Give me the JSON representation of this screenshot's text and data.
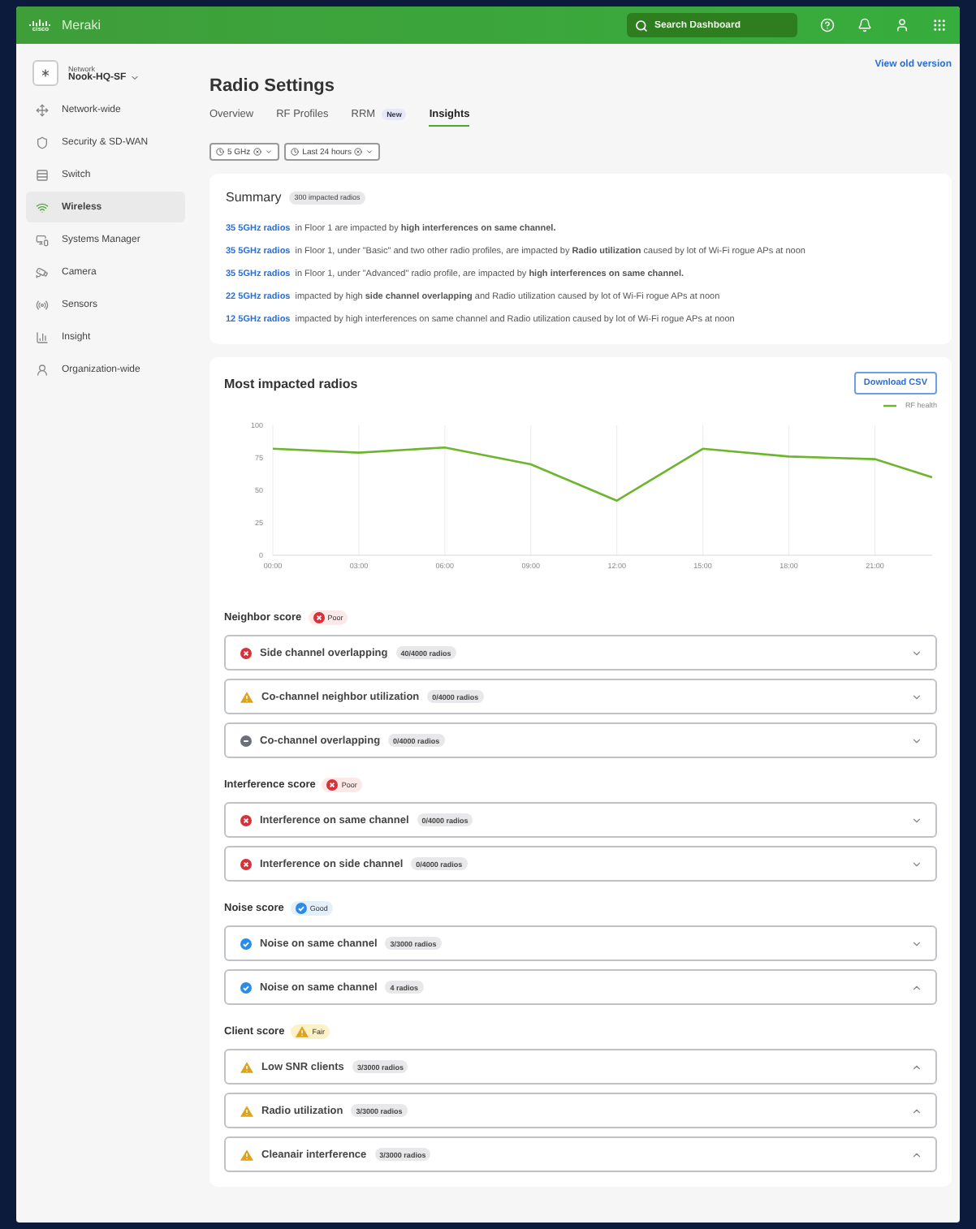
{
  "header": {
    "logo_mark": "cisco",
    "brand": "Meraki",
    "search": {
      "placeholder": "Search Dashboard"
    }
  },
  "sidebar": {
    "network_label": "Network",
    "network_name": "Nook-HQ-SF",
    "items": [
      {
        "label": "Network-wide",
        "selected": false
      },
      {
        "label": "Security & SD-WAN",
        "selected": false
      },
      {
        "label": "Switch",
        "selected": false
      },
      {
        "label": "Wireless",
        "selected": true
      },
      {
        "label": "Systems Manager",
        "selected": false
      },
      {
        "label": "Camera",
        "selected": false
      },
      {
        "label": "Sensors",
        "selected": false
      },
      {
        "label": "Insight",
        "selected": false
      },
      {
        "label": "Organization-wide",
        "selected": false
      }
    ]
  },
  "page": {
    "title": "Radio Settings",
    "view_old": "View old version",
    "tabs": [
      {
        "label": "Overview",
        "selected": false
      },
      {
        "label": "RF Profiles",
        "selected": false
      },
      {
        "label": "RRM",
        "badge": "New",
        "selected": false
      },
      {
        "label": "Insights",
        "selected": true
      }
    ],
    "filters": [
      "5 GHz",
      "Last 24 hours"
    ]
  },
  "summary": {
    "title": "Summary",
    "badge": "300 impacted radios",
    "lines": [
      {
        "link": "35 5GHz radios",
        "text": "in Floor 1 are impacted by **high interferences on same channel.**"
      },
      {
        "link": "35 5GHz radios",
        "text": "in Floor 1, under \"Basic\" and two other radio profiles,  are impacted by  **Radio utilization** caused by lot of Wi-Fi rogue APs at noon"
      },
      {
        "link": "35 5GHz radios",
        "text": "in Floor 1, under \"Advanced\" radio profile,  are impacted by **high interferences on same channel.**"
      },
      {
        "link": "22 5GHz radios",
        "text": "impacted by high **side channel overlapping** and Radio utilization caused by lot of Wi-Fi rogue APs at noon"
      },
      {
        "link": "12 5GHz radios",
        "text": "impacted by high interferences on same channel and Radio utilization caused by lot of Wi-Fi rogue APs at noon"
      }
    ]
  },
  "impacted": {
    "title": "Most impacted radios",
    "download": "Download CSV",
    "chart_data": {
      "type": "line",
      "x": [
        0,
        3,
        6,
        9,
        12,
        15,
        18,
        21,
        23
      ],
      "series": [
        {
          "name": "RF health",
          "color": "#6cb52d",
          "values": [
            82,
            79,
            83,
            70,
            42,
            82,
            76,
            74,
            60
          ]
        }
      ],
      "grid": true,
      "xlim": [
        0,
        23
      ],
      "ylim": [
        0,
        100
      ],
      "xticks": [
        {
          "value": 0,
          "label": "00:00"
        },
        {
          "value": 3,
          "label": "03:00"
        },
        {
          "value": 6,
          "label": "06:00"
        },
        {
          "value": 9,
          "label": "09:00"
        },
        {
          "value": 12,
          "label": "12:00"
        },
        {
          "value": 15,
          "label": "15:00"
        },
        {
          "value": 18,
          "label": "18:00"
        },
        {
          "value": 21,
          "label": "21:00"
        }
      ],
      "yticks": [
        0,
        25,
        50,
        75,
        100
      ]
    },
    "scores": [
      {
        "title": "Neighbor score",
        "status": "Poor",
        "kind": "poor",
        "items": [
          {
            "kind": "error",
            "label": "Side channel overlapping",
            "count": "40/4000 radios",
            "expanded": false
          },
          {
            "kind": "warning",
            "label": "Co-channel neighbor utilization",
            "count": "0/4000 radios",
            "expanded": false
          },
          {
            "kind": "neutral",
            "label": "Co-channel overlapping",
            "count": "0/4000 radios",
            "expanded": false
          }
        ]
      },
      {
        "title": "Interference score",
        "status": "Poor",
        "kind": "poor",
        "items": [
          {
            "kind": "error",
            "label": "Interference on same channel",
            "count": "0/4000 radios",
            "expanded": false
          },
          {
            "kind": "error",
            "label": "Interference on side channel",
            "count": "0/4000 radios",
            "expanded": false
          }
        ]
      },
      {
        "title": "Noise score",
        "status": "Good",
        "kind": "good",
        "items": [
          {
            "kind": "ok",
            "label": "Noise on same channel",
            "count": "3/3000 radios",
            "expanded": false
          },
          {
            "kind": "ok",
            "label": "Noise on same channel",
            "count": "4 radios",
            "expanded": true
          }
        ]
      },
      {
        "title": "Client score",
        "status": "Fair",
        "kind": "fair",
        "items": [
          {
            "kind": "warning",
            "label": "Low SNR clients",
            "count": "3/3000 radios",
            "expanded": true
          },
          {
            "kind": "warning",
            "label": "Radio utilization",
            "count": "3/3000 radios",
            "expanded": true
          },
          {
            "kind": "warning",
            "label": "Cleanair interference",
            "count": "3/3000 radios",
            "expanded": true
          }
        ]
      }
    ]
  }
}
